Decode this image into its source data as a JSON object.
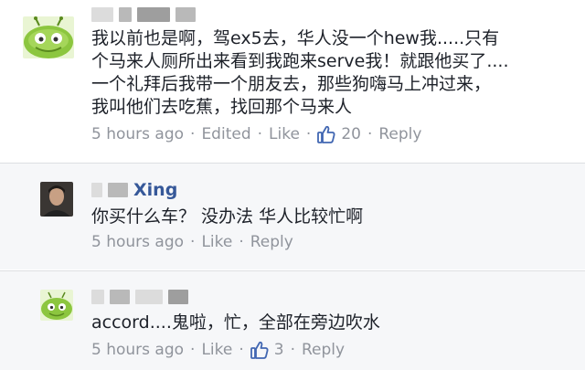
{
  "comments": [
    {
      "author": "",
      "lines": [
        "我以前也是啊，驾ex5去，华人没一个hew我.....只有",
        "个马来人厕所出来看到我跑来serve我！就跟他买了....",
        "一个礼拜后我带一个朋友去，那些狗嗨马上冲过来，",
        "我叫他们去吃蕉，找回那个马来人"
      ],
      "time": "5 hours ago",
      "edited": "Edited",
      "like": "Like",
      "like_count": "20",
      "reply": "Reply"
    },
    {
      "author": "Xing",
      "lines": [
        "你买什么车？ 没办法 华人比较忙啊"
      ],
      "time": "5 hours ago",
      "like": "Like",
      "reply": "Reply"
    },
    {
      "author": "",
      "lines": [
        "accord....鬼啦，忙，全部在旁边吹水"
      ],
      "time": "5 hours ago",
      "like": "Like",
      "like_count": "3",
      "reply": "Reply"
    }
  ],
  "colors": {
    "meta": "#90949c",
    "name": "#365899",
    "text": "#1d2129",
    "reply_bg": "#f6f7f9"
  },
  "icons": [
    "alien-avatar",
    "user-photo-avatar",
    "thumbs-up-icon"
  ]
}
